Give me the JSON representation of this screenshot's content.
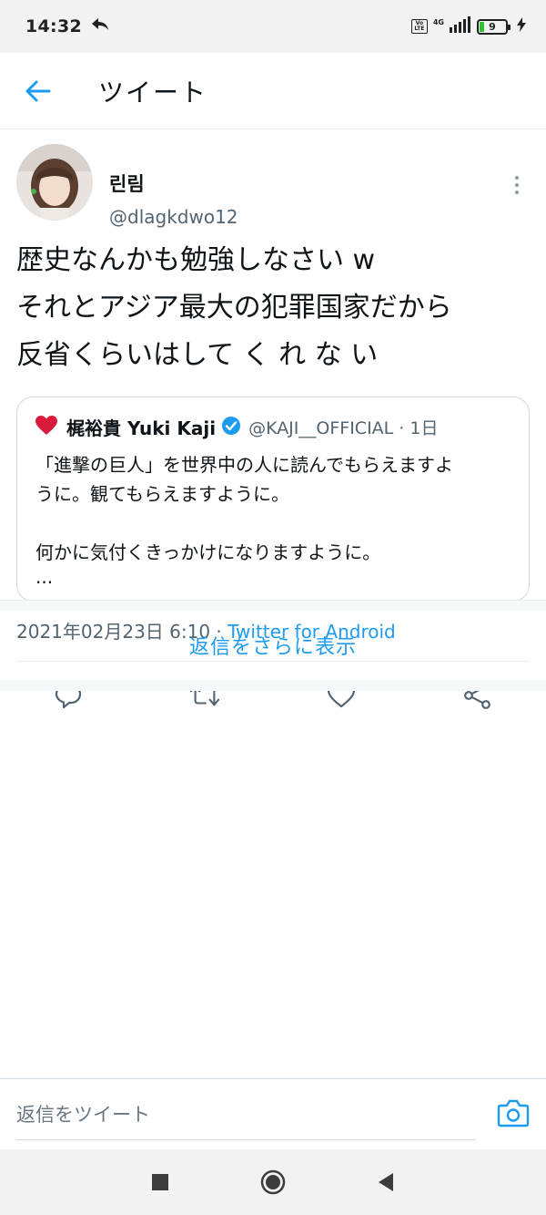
{
  "status_bar": {
    "time": "14:32",
    "volte": "Vo LTE",
    "network": "4G",
    "battery": "9"
  },
  "header": {
    "title": "ツイート"
  },
  "tweet": {
    "author_name": "린림",
    "author_handle": "@dlagkdwo12",
    "text_lines": [
      "歴史なんかも勉強しなさい w",
      "それとアジア最大の犯罪国家だから",
      "反省くらいはして く れ な い"
    ],
    "quoted": {
      "name": "梶裕貴 Yuki Kaji",
      "handle_time": "@KAJI__OFFICIAL · 1日",
      "body_lines": [
        "「進撃の巨人」を世界中の人に読んでもらえますよ",
        "うに。観てもらえますように。",
        "",
        "何かに気付くきっかけになりますように。",
        "..."
      ]
    },
    "timestamp": "2021年02月23日 6:10 · ",
    "client": "Twitter for Android"
  },
  "more_replies": "返信をさらに表示",
  "reply": {
    "placeholder": "返信をツイート"
  },
  "colors": {
    "accent": "#1d9bf0",
    "secondary_text": "#536471",
    "border": "#cfd9de"
  }
}
